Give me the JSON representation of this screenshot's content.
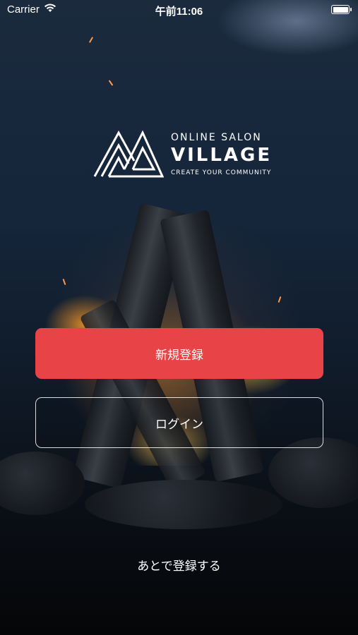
{
  "status_bar": {
    "carrier": "Carrier",
    "time": "午前11:06",
    "battery": 1.0
  },
  "logo": {
    "line1": "ONLINE SALON",
    "line2": "VILLAGE",
    "line3": "CREATE YOUR COMMUNITY",
    "icon": "mountain-logo-icon"
  },
  "actions": {
    "register_label": "新規登録",
    "login_label": "ログイン",
    "later_label": "あとで登録する"
  },
  "colors": {
    "register_button": "#e84346",
    "text": "#ffffff"
  }
}
